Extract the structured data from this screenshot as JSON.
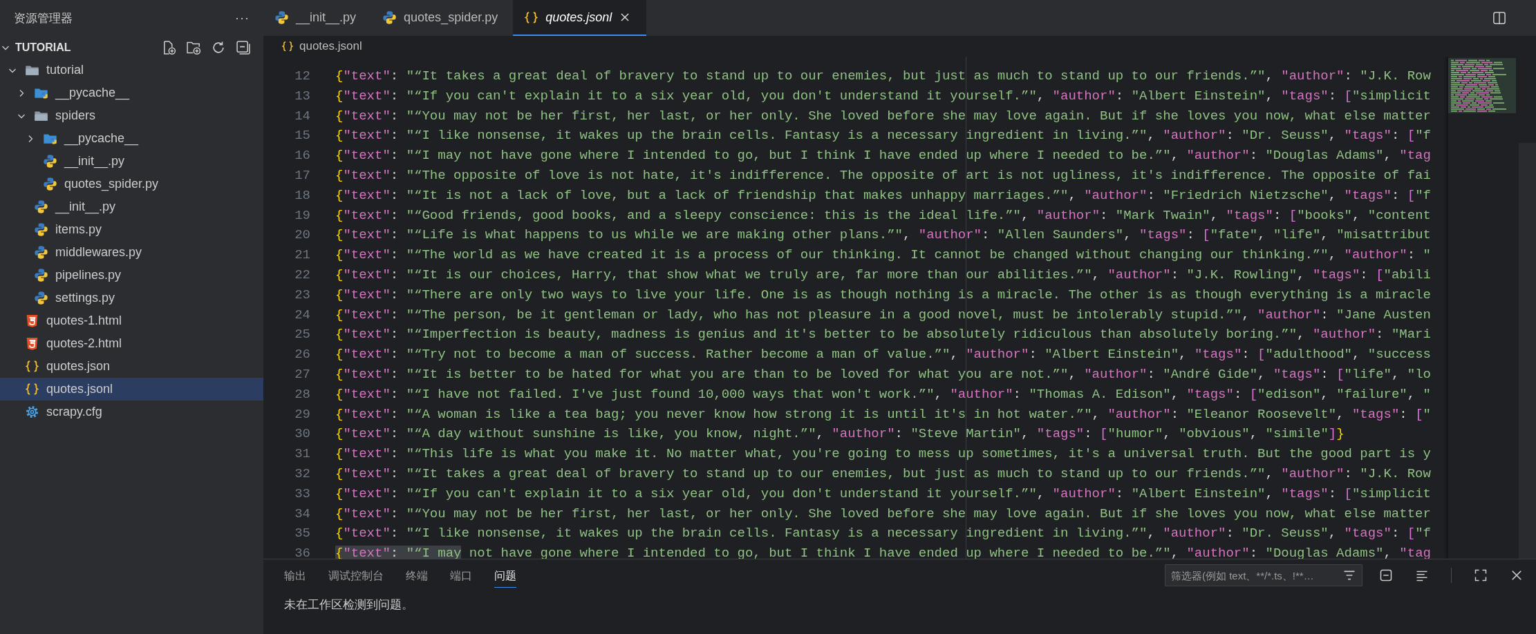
{
  "sidebar": {
    "title": "资源管理器",
    "more": "···",
    "section": {
      "title": "TUTORIAL",
      "expanded": true,
      "items": [
        {
          "label": "tutorial",
          "kind": "folder",
          "expanded": true,
          "selected": false,
          "children": [
            {
              "label": "__pycache__",
              "kind": "python-folder",
              "expanded": false,
              "selected": false
            },
            {
              "label": "spiders",
              "kind": "folder",
              "expanded": true,
              "selected": false,
              "children": [
                {
                  "label": "__pycache__",
                  "kind": "python-folder",
                  "expanded": false,
                  "selected": false
                },
                {
                  "label": "__init__.py",
                  "kind": "python",
                  "selected": false
                },
                {
                  "label": "quotes_spider.py",
                  "kind": "python",
                  "selected": false
                }
              ]
            },
            {
              "label": "__init__.py",
              "kind": "python",
              "selected": false
            },
            {
              "label": "items.py",
              "kind": "python",
              "selected": false
            },
            {
              "label": "middlewares.py",
              "kind": "python",
              "selected": false
            },
            {
              "label": "pipelines.py",
              "kind": "python",
              "selected": false
            },
            {
              "label": "settings.py",
              "kind": "python",
              "selected": false
            }
          ]
        },
        {
          "label": "quotes-1.html",
          "kind": "html",
          "selected": false
        },
        {
          "label": "quotes-2.html",
          "kind": "html",
          "selected": false
        },
        {
          "label": "quotes.json",
          "kind": "json",
          "selected": false
        },
        {
          "label": "quotes.jsonl",
          "kind": "json",
          "selected": true
        },
        {
          "label": "scrapy.cfg",
          "kind": "config",
          "selected": false
        }
      ]
    }
  },
  "tabs": [
    {
      "label": "__init__.py",
      "kind": "python",
      "selected": false,
      "preview": false
    },
    {
      "label": "quotes_spider.py",
      "kind": "python",
      "selected": false,
      "preview": false
    },
    {
      "label": "quotes.jsonl",
      "kind": "json",
      "selected": true,
      "preview": true
    }
  ],
  "breadcrumb": {
    "label": "quotes.jsonl",
    "kind": "json"
  },
  "editor": {
    "lines": [
      {
        "number": "12",
        "segments": [
          {
            "kind": "brace",
            "text": "{"
          },
          {
            "kind": "key",
            "text": "\"text\""
          },
          {
            "kind": "punct",
            "text": ": "
          },
          {
            "kind": "string",
            "text": "\"“It takes a great deal of bravery to stand up to our enemies, but just as much to stand up to our friends.”\""
          },
          {
            "kind": "punct",
            "text": ", "
          },
          {
            "kind": "key",
            "text": "\"author\""
          },
          {
            "kind": "punct",
            "text": ": "
          },
          {
            "kind": "string",
            "text": "\"J.K. Row"
          }
        ]
      },
      {
        "number": "13",
        "segments": [
          {
            "kind": "brace",
            "text": "{"
          },
          {
            "kind": "key",
            "text": "\"text\""
          },
          {
            "kind": "punct",
            "text": ": "
          },
          {
            "kind": "string",
            "text": "\"“If you can't explain it to a six year old, you don't understand it yourself.”\""
          },
          {
            "kind": "punct",
            "text": ", "
          },
          {
            "kind": "key",
            "text": "\"author\""
          },
          {
            "kind": "punct",
            "text": ": "
          },
          {
            "kind": "string",
            "text": "\"Albert Einstein\""
          },
          {
            "kind": "punct",
            "text": ", "
          },
          {
            "kind": "key",
            "text": "\"tags\""
          },
          {
            "kind": "punct",
            "text": ": "
          },
          {
            "kind": "bracket",
            "text": "["
          },
          {
            "kind": "string",
            "text": "\"simplicit"
          }
        ]
      },
      {
        "number": "14",
        "segments": [
          {
            "kind": "brace",
            "text": "{"
          },
          {
            "kind": "key",
            "text": "\"text\""
          },
          {
            "kind": "punct",
            "text": ": "
          },
          {
            "kind": "string",
            "text": "\"“You may not be her first, her last, or her only. She loved before she may love again. But if she loves you now, what else matter"
          }
        ]
      },
      {
        "number": "15",
        "segments": [
          {
            "kind": "brace",
            "text": "{"
          },
          {
            "kind": "key",
            "text": "\"text\""
          },
          {
            "kind": "punct",
            "text": ": "
          },
          {
            "kind": "string",
            "text": "\"“I like nonsense, it wakes up the brain cells. Fantasy is a necessary ingredient in living.”\""
          },
          {
            "kind": "punct",
            "text": ", "
          },
          {
            "kind": "key",
            "text": "\"author\""
          },
          {
            "kind": "punct",
            "text": ": "
          },
          {
            "kind": "string",
            "text": "\"Dr. Seuss\""
          },
          {
            "kind": "punct",
            "text": ", "
          },
          {
            "kind": "key",
            "text": "\"tags\""
          },
          {
            "kind": "punct",
            "text": ": "
          },
          {
            "kind": "bracket",
            "text": "["
          },
          {
            "kind": "string",
            "text": "\"f"
          }
        ]
      },
      {
        "number": "16",
        "segments": [
          {
            "kind": "brace",
            "text": "{"
          },
          {
            "kind": "key",
            "text": "\"text\""
          },
          {
            "kind": "punct",
            "text": ": "
          },
          {
            "kind": "string",
            "text": "\"“I may not have gone where I intended to go, but I think I have ended up where I needed to be.”\""
          },
          {
            "kind": "punct",
            "text": ", "
          },
          {
            "kind": "key",
            "text": "\"author\""
          },
          {
            "kind": "punct",
            "text": ": "
          },
          {
            "kind": "string",
            "text": "\"Douglas Adams\""
          },
          {
            "kind": "punct",
            "text": ", "
          },
          {
            "kind": "key",
            "text": "\"tag"
          }
        ]
      },
      {
        "number": "17",
        "segments": [
          {
            "kind": "brace",
            "text": "{"
          },
          {
            "kind": "key",
            "text": "\"text\""
          },
          {
            "kind": "punct",
            "text": ": "
          },
          {
            "kind": "string",
            "text": "\"“The opposite of love is not hate, it's indifference. The opposite of art is not ugliness, it's indifference. The opposite of fai"
          }
        ]
      },
      {
        "number": "18",
        "segments": [
          {
            "kind": "brace",
            "text": "{"
          },
          {
            "kind": "key",
            "text": "\"text\""
          },
          {
            "kind": "punct",
            "text": ": "
          },
          {
            "kind": "string",
            "text": "\"“It is not a lack of love, but a lack of friendship that makes unhappy marriages.”\""
          },
          {
            "kind": "punct",
            "text": ", "
          },
          {
            "kind": "key",
            "text": "\"author\""
          },
          {
            "kind": "punct",
            "text": ": "
          },
          {
            "kind": "string",
            "text": "\"Friedrich Nietzsche\""
          },
          {
            "kind": "punct",
            "text": ", "
          },
          {
            "kind": "key",
            "text": "\"tags\""
          },
          {
            "kind": "punct",
            "text": ": "
          },
          {
            "kind": "bracket",
            "text": "["
          },
          {
            "kind": "string",
            "text": "\"f"
          }
        ]
      },
      {
        "number": "19",
        "segments": [
          {
            "kind": "brace",
            "text": "{"
          },
          {
            "kind": "key",
            "text": "\"text\""
          },
          {
            "kind": "punct",
            "text": ": "
          },
          {
            "kind": "string",
            "text": "\"“Good friends, good books, and a sleepy conscience: this is the ideal life.”\""
          },
          {
            "kind": "punct",
            "text": ", "
          },
          {
            "kind": "key",
            "text": "\"author\""
          },
          {
            "kind": "punct",
            "text": ": "
          },
          {
            "kind": "string",
            "text": "\"Mark Twain\""
          },
          {
            "kind": "punct",
            "text": ", "
          },
          {
            "kind": "key",
            "text": "\"tags\""
          },
          {
            "kind": "punct",
            "text": ": "
          },
          {
            "kind": "bracket",
            "text": "["
          },
          {
            "kind": "string",
            "text": "\"books\""
          },
          {
            "kind": "punct",
            "text": ", "
          },
          {
            "kind": "string",
            "text": "\"content"
          }
        ]
      },
      {
        "number": "20",
        "segments": [
          {
            "kind": "brace",
            "text": "{"
          },
          {
            "kind": "key",
            "text": "\"text\""
          },
          {
            "kind": "punct",
            "text": ": "
          },
          {
            "kind": "string",
            "text": "\"“Life is what happens to us while we are making other plans.”\""
          },
          {
            "kind": "punct",
            "text": ", "
          },
          {
            "kind": "key",
            "text": "\"author\""
          },
          {
            "kind": "punct",
            "text": ": "
          },
          {
            "kind": "string",
            "text": "\"Allen Saunders\""
          },
          {
            "kind": "punct",
            "text": ", "
          },
          {
            "kind": "key",
            "text": "\"tags\""
          },
          {
            "kind": "punct",
            "text": ": "
          },
          {
            "kind": "bracket",
            "text": "["
          },
          {
            "kind": "string",
            "text": "\"fate\""
          },
          {
            "kind": "punct",
            "text": ", "
          },
          {
            "kind": "string",
            "text": "\"life\""
          },
          {
            "kind": "punct",
            "text": ", "
          },
          {
            "kind": "string",
            "text": "\"misattribut"
          }
        ]
      },
      {
        "number": "21",
        "segments": [
          {
            "kind": "brace",
            "text": "{"
          },
          {
            "kind": "key",
            "text": "\"text\""
          },
          {
            "kind": "punct",
            "text": ": "
          },
          {
            "kind": "string",
            "text": "\"“The world as we have created it is a process of our thinking. It cannot be changed without changing our thinking.”\""
          },
          {
            "kind": "punct",
            "text": ", "
          },
          {
            "kind": "key",
            "text": "\"author\""
          },
          {
            "kind": "punct",
            "text": ": "
          },
          {
            "kind": "string",
            "text": "\""
          }
        ]
      },
      {
        "number": "22",
        "segments": [
          {
            "kind": "brace",
            "text": "{"
          },
          {
            "kind": "key",
            "text": "\"text\""
          },
          {
            "kind": "punct",
            "text": ": "
          },
          {
            "kind": "string",
            "text": "\"“It is our choices, Harry, that show what we truly are, far more than our abilities.”\""
          },
          {
            "kind": "punct",
            "text": ", "
          },
          {
            "kind": "key",
            "text": "\"author\""
          },
          {
            "kind": "punct",
            "text": ": "
          },
          {
            "kind": "string",
            "text": "\"J.K. Rowling\""
          },
          {
            "kind": "punct",
            "text": ", "
          },
          {
            "kind": "key",
            "text": "\"tags\""
          },
          {
            "kind": "punct",
            "text": ": "
          },
          {
            "kind": "bracket",
            "text": "["
          },
          {
            "kind": "string",
            "text": "\"abili"
          }
        ]
      },
      {
        "number": "23",
        "segments": [
          {
            "kind": "brace",
            "text": "{"
          },
          {
            "kind": "key",
            "text": "\"text\""
          },
          {
            "kind": "punct",
            "text": ": "
          },
          {
            "kind": "string",
            "text": "\"“There are only two ways to live your life. One is as though nothing is a miracle. The other is as though everything is a miracle"
          }
        ]
      },
      {
        "number": "24",
        "segments": [
          {
            "kind": "brace",
            "text": "{"
          },
          {
            "kind": "key",
            "text": "\"text\""
          },
          {
            "kind": "punct",
            "text": ": "
          },
          {
            "kind": "string",
            "text": "\"“The person, be it gentleman or lady, who has not pleasure in a good novel, must be intolerably stupid.”\""
          },
          {
            "kind": "punct",
            "text": ", "
          },
          {
            "kind": "key",
            "text": "\"author\""
          },
          {
            "kind": "punct",
            "text": ": "
          },
          {
            "kind": "string",
            "text": "\"Jane Austen"
          }
        ]
      },
      {
        "number": "25",
        "segments": [
          {
            "kind": "brace",
            "text": "{"
          },
          {
            "kind": "key",
            "text": "\"text\""
          },
          {
            "kind": "punct",
            "text": ": "
          },
          {
            "kind": "string",
            "text": "\"“Imperfection is beauty, madness is genius and it's better to be absolutely ridiculous than absolutely boring.”\""
          },
          {
            "kind": "punct",
            "text": ", "
          },
          {
            "kind": "key",
            "text": "\"author\""
          },
          {
            "kind": "punct",
            "text": ": "
          },
          {
            "kind": "string",
            "text": "\"Mari"
          }
        ]
      },
      {
        "number": "26",
        "segments": [
          {
            "kind": "brace",
            "text": "{"
          },
          {
            "kind": "key",
            "text": "\"text\""
          },
          {
            "kind": "punct",
            "text": ": "
          },
          {
            "kind": "string",
            "text": "\"“Try not to become a man of success. Rather become a man of value.”\""
          },
          {
            "kind": "punct",
            "text": ", "
          },
          {
            "kind": "key",
            "text": "\"author\""
          },
          {
            "kind": "punct",
            "text": ": "
          },
          {
            "kind": "string",
            "text": "\"Albert Einstein\""
          },
          {
            "kind": "punct",
            "text": ", "
          },
          {
            "kind": "key",
            "text": "\"tags\""
          },
          {
            "kind": "punct",
            "text": ": "
          },
          {
            "kind": "bracket",
            "text": "["
          },
          {
            "kind": "string",
            "text": "\"adulthood\""
          },
          {
            "kind": "punct",
            "text": ", "
          },
          {
            "kind": "string",
            "text": "\"success"
          }
        ]
      },
      {
        "number": "27",
        "segments": [
          {
            "kind": "brace",
            "text": "{"
          },
          {
            "kind": "key",
            "text": "\"text\""
          },
          {
            "kind": "punct",
            "text": ": "
          },
          {
            "kind": "string",
            "text": "\"“It is better to be hated for what you are than to be loved for what you are not.”\""
          },
          {
            "kind": "punct",
            "text": ", "
          },
          {
            "kind": "key",
            "text": "\"author\""
          },
          {
            "kind": "punct",
            "text": ": "
          },
          {
            "kind": "string",
            "text": "\"André Gide\""
          },
          {
            "kind": "punct",
            "text": ", "
          },
          {
            "kind": "key",
            "text": "\"tags\""
          },
          {
            "kind": "punct",
            "text": ": "
          },
          {
            "kind": "bracket",
            "text": "["
          },
          {
            "kind": "string",
            "text": "\"life\""
          },
          {
            "kind": "punct",
            "text": ", "
          },
          {
            "kind": "string",
            "text": "\"lo"
          }
        ]
      },
      {
        "number": "28",
        "segments": [
          {
            "kind": "brace",
            "text": "{"
          },
          {
            "kind": "key",
            "text": "\"text\""
          },
          {
            "kind": "punct",
            "text": ": "
          },
          {
            "kind": "string",
            "text": "\"“I have not failed. I've just found 10,000 ways that won't work.”\""
          },
          {
            "kind": "punct",
            "text": ", "
          },
          {
            "kind": "key",
            "text": "\"author\""
          },
          {
            "kind": "punct",
            "text": ": "
          },
          {
            "kind": "string",
            "text": "\"Thomas A. Edison\""
          },
          {
            "kind": "punct",
            "text": ", "
          },
          {
            "kind": "key",
            "text": "\"tags\""
          },
          {
            "kind": "punct",
            "text": ": "
          },
          {
            "kind": "bracket",
            "text": "["
          },
          {
            "kind": "string",
            "text": "\"edison\""
          },
          {
            "kind": "punct",
            "text": ", "
          },
          {
            "kind": "string",
            "text": "\"failure\""
          },
          {
            "kind": "punct",
            "text": ", "
          },
          {
            "kind": "string",
            "text": "\""
          }
        ]
      },
      {
        "number": "29",
        "segments": [
          {
            "kind": "brace",
            "text": "{"
          },
          {
            "kind": "key",
            "text": "\"text\""
          },
          {
            "kind": "punct",
            "text": ": "
          },
          {
            "kind": "string",
            "text": "\"“A woman is like a tea bag; you never know how strong it is until it's in hot water.”\""
          },
          {
            "kind": "punct",
            "text": ", "
          },
          {
            "kind": "key",
            "text": "\"author\""
          },
          {
            "kind": "punct",
            "text": ": "
          },
          {
            "kind": "string",
            "text": "\"Eleanor Roosevelt\""
          },
          {
            "kind": "punct",
            "text": ", "
          },
          {
            "kind": "key",
            "text": "\"tags\""
          },
          {
            "kind": "punct",
            "text": ": "
          },
          {
            "kind": "bracket",
            "text": "["
          },
          {
            "kind": "string",
            "text": "\""
          }
        ]
      },
      {
        "number": "30",
        "segments": [
          {
            "kind": "brace",
            "text": "{"
          },
          {
            "kind": "key",
            "text": "\"text\""
          },
          {
            "kind": "punct",
            "text": ": "
          },
          {
            "kind": "string",
            "text": "\"“A day without sunshine is like, you know, night.”\""
          },
          {
            "kind": "punct",
            "text": ", "
          },
          {
            "kind": "key",
            "text": "\"author\""
          },
          {
            "kind": "punct",
            "text": ": "
          },
          {
            "kind": "string",
            "text": "\"Steve Martin\""
          },
          {
            "kind": "punct",
            "text": ", "
          },
          {
            "kind": "key",
            "text": "\"tags\""
          },
          {
            "kind": "punct",
            "text": ": "
          },
          {
            "kind": "bracket",
            "text": "["
          },
          {
            "kind": "string",
            "text": "\"humor\""
          },
          {
            "kind": "punct",
            "text": ", "
          },
          {
            "kind": "string",
            "text": "\"obvious\""
          },
          {
            "kind": "punct",
            "text": ", "
          },
          {
            "kind": "string",
            "text": "\"simile\""
          },
          {
            "kind": "bracket",
            "text": "]"
          },
          {
            "kind": "brace",
            "text": "}"
          }
        ]
      },
      {
        "number": "31",
        "segments": [
          {
            "kind": "brace",
            "text": "{"
          },
          {
            "kind": "key",
            "text": "\"text\""
          },
          {
            "kind": "punct",
            "text": ": "
          },
          {
            "kind": "string",
            "text": "\"“This life is what you make it. No matter what, you're going to mess up sometimes, it's a universal truth. But the good part is y"
          }
        ]
      },
      {
        "number": "32",
        "segments": [
          {
            "kind": "brace",
            "text": "{"
          },
          {
            "kind": "key",
            "text": "\"text\""
          },
          {
            "kind": "punct",
            "text": ": "
          },
          {
            "kind": "string",
            "text": "\"“It takes a great deal of bravery to stand up to our enemies, but just as much to stand up to our friends.”\""
          },
          {
            "kind": "punct",
            "text": ", "
          },
          {
            "kind": "key",
            "text": "\"author\""
          },
          {
            "kind": "punct",
            "text": ": "
          },
          {
            "kind": "string",
            "text": "\"J.K. Row"
          }
        ]
      },
      {
        "number": "33",
        "segments": [
          {
            "kind": "brace",
            "text": "{"
          },
          {
            "kind": "key",
            "text": "\"text\""
          },
          {
            "kind": "punct",
            "text": ": "
          },
          {
            "kind": "string",
            "text": "\"“If you can't explain it to a six year old, you don't understand it yourself.”\""
          },
          {
            "kind": "punct",
            "text": ", "
          },
          {
            "kind": "key",
            "text": "\"author\""
          },
          {
            "kind": "punct",
            "text": ": "
          },
          {
            "kind": "string",
            "text": "\"Albert Einstein\""
          },
          {
            "kind": "punct",
            "text": ", "
          },
          {
            "kind": "key",
            "text": "\"tags\""
          },
          {
            "kind": "punct",
            "text": ": "
          },
          {
            "kind": "bracket",
            "text": "["
          },
          {
            "kind": "string",
            "text": "\"simplicit"
          }
        ]
      },
      {
        "number": "34",
        "segments": [
          {
            "kind": "brace",
            "text": "{"
          },
          {
            "kind": "key",
            "text": "\"text\""
          },
          {
            "kind": "punct",
            "text": ": "
          },
          {
            "kind": "string",
            "text": "\"“You may not be her first, her last, or her only. She loved before she may love again. But if she loves you now, what else matter"
          }
        ]
      },
      {
        "number": "35",
        "segments": [
          {
            "kind": "brace",
            "text": "{"
          },
          {
            "kind": "key",
            "text": "\"text\""
          },
          {
            "kind": "punct",
            "text": ": "
          },
          {
            "kind": "string",
            "text": "\"“I like nonsense, it wakes up the brain cells. Fantasy is a necessary ingredient in living.”\""
          },
          {
            "kind": "punct",
            "text": ", "
          },
          {
            "kind": "key",
            "text": "\"author\""
          },
          {
            "kind": "punct",
            "text": ": "
          },
          {
            "kind": "string",
            "text": "\"Dr. Seuss\""
          },
          {
            "kind": "punct",
            "text": ", "
          },
          {
            "kind": "key",
            "text": "\"tags\""
          },
          {
            "kind": "punct",
            "text": ": "
          },
          {
            "kind": "bracket",
            "text": "["
          },
          {
            "kind": "string",
            "text": "\"f"
          }
        ]
      },
      {
        "number": "36",
        "segments": [
          {
            "kind": "brace",
            "text": "{",
            "highlighted": true
          },
          {
            "kind": "key",
            "text": "\"text\"",
            "highlighted": true
          },
          {
            "kind": "punct",
            "text": ": ",
            "highlighted": true
          },
          {
            "kind": "string",
            "text": "\"“I may",
            "highlighted": true
          },
          {
            "kind": "string",
            "text": " not have gone where I intended to go, but I think I have ended up where I needed to be.”\""
          },
          {
            "kind": "punct",
            "text": ", "
          },
          {
            "kind": "key",
            "text": "\"author\""
          },
          {
            "kind": "punct",
            "text": ": "
          },
          {
            "kind": "string",
            "text": "\"Douglas Adams\""
          },
          {
            "kind": "punct",
            "text": ", "
          },
          {
            "kind": "key",
            "text": "\"tag"
          }
        ]
      }
    ]
  },
  "panel": {
    "tabs": [
      {
        "label": "输出",
        "selected": false
      },
      {
        "label": "调试控制台",
        "selected": false
      },
      {
        "label": "终端",
        "selected": false
      },
      {
        "label": "端口",
        "selected": false
      },
      {
        "label": "问题",
        "selected": true
      }
    ],
    "filter": {
      "placeholder": "筛选器(例如 text、**/*.ts、!**…"
    },
    "message": "未在工作区检测到问题。"
  }
}
